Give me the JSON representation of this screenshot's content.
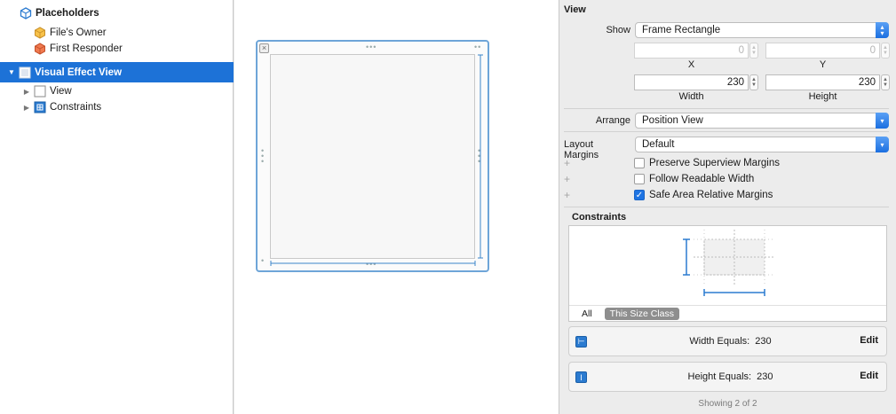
{
  "outline": {
    "placeholders_label": "Placeholders",
    "files_owner_label": "File's Owner",
    "first_responder_label": "First Responder",
    "visual_effect_view_label": "Visual Effect View",
    "view_label": "View",
    "constraints_label": "Constraints"
  },
  "inspector": {
    "view_section_title": "View",
    "show_label": "Show",
    "show_value": "Frame Rectangle",
    "x_value": "0",
    "y_value": "0",
    "x_label": "X",
    "y_label": "Y",
    "width_value": "230",
    "height_value": "230",
    "width_label": "Width",
    "height_label": "Height",
    "arrange_label": "Arrange",
    "arrange_value": "Position View",
    "layout_margins_label": "Layout Margins",
    "layout_margins_value": "Default",
    "preserve_superview_margins": "Preserve Superview Margins",
    "follow_readable_width": "Follow Readable Width",
    "safe_area_relative_margins": "Safe Area Relative Margins",
    "constraints_section_title": "Constraints",
    "tab_all": "All",
    "tab_this_size_class": "This Size Class",
    "width_equals_label": "Width Equals:",
    "width_equals_value": "230",
    "height_equals_label": "Height Equals:",
    "height_equals_value": "230",
    "edit_label": "Edit",
    "showing_text": "Showing 2 of 2"
  },
  "colors": {
    "selection": "#1d72d7",
    "accent": "#2b7bd0",
    "frame_border": "#6ea5d8"
  }
}
